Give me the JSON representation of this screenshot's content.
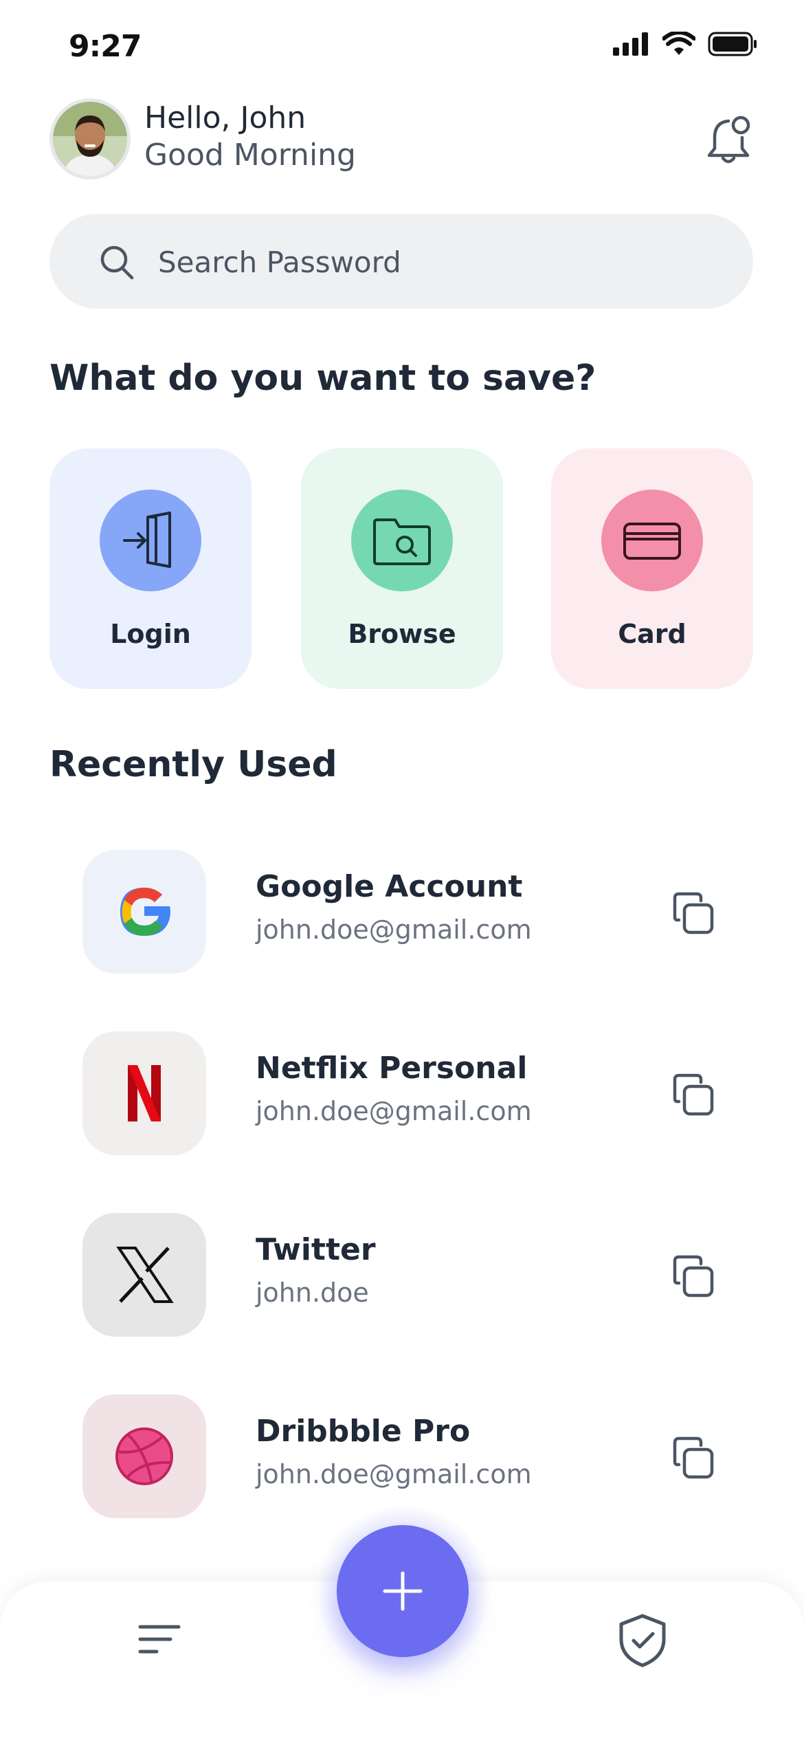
{
  "status_bar": {
    "time": "9:27"
  },
  "header": {
    "greeting": "Hello, John",
    "subtitle": "Good Morning"
  },
  "search": {
    "placeholder": "Search Password"
  },
  "categories_section": {
    "title": "What do you want to save?",
    "items": [
      {
        "label": "Login",
        "icon": "login-icon",
        "bg": "#eaf0fe",
        "circle": "#86a6f8"
      },
      {
        "label": "Browse",
        "icon": "folder-search-icon",
        "bg": "#e8f7f0",
        "circle": "#76d8b1"
      },
      {
        "label": "Card",
        "icon": "credit-card-icon",
        "bg": "#fdecef",
        "circle": "#f38fa9"
      }
    ]
  },
  "recent_section": {
    "title": "Recently Used",
    "items": [
      {
        "title": "Google Account",
        "subtitle": "john.doe@gmail.com",
        "icon": "google-logo"
      },
      {
        "title": "Netflix Personal",
        "subtitle": "john.doe@gmail.com",
        "icon": "netflix-logo"
      },
      {
        "title": "Twitter",
        "subtitle": "john.doe",
        "icon": "x-logo"
      },
      {
        "title": "Dribbble Pro",
        "subtitle": "john.doe@gmail.com",
        "icon": "dribbble-logo"
      }
    ]
  },
  "bottom_nav": {
    "left_icon": "menu-icon",
    "center_icon": "plus-icon",
    "right_icon": "shield-check-icon"
  },
  "colors": {
    "accent": "#6b6cf0",
    "text": "#1f2937",
    "muted": "#6b7280"
  }
}
